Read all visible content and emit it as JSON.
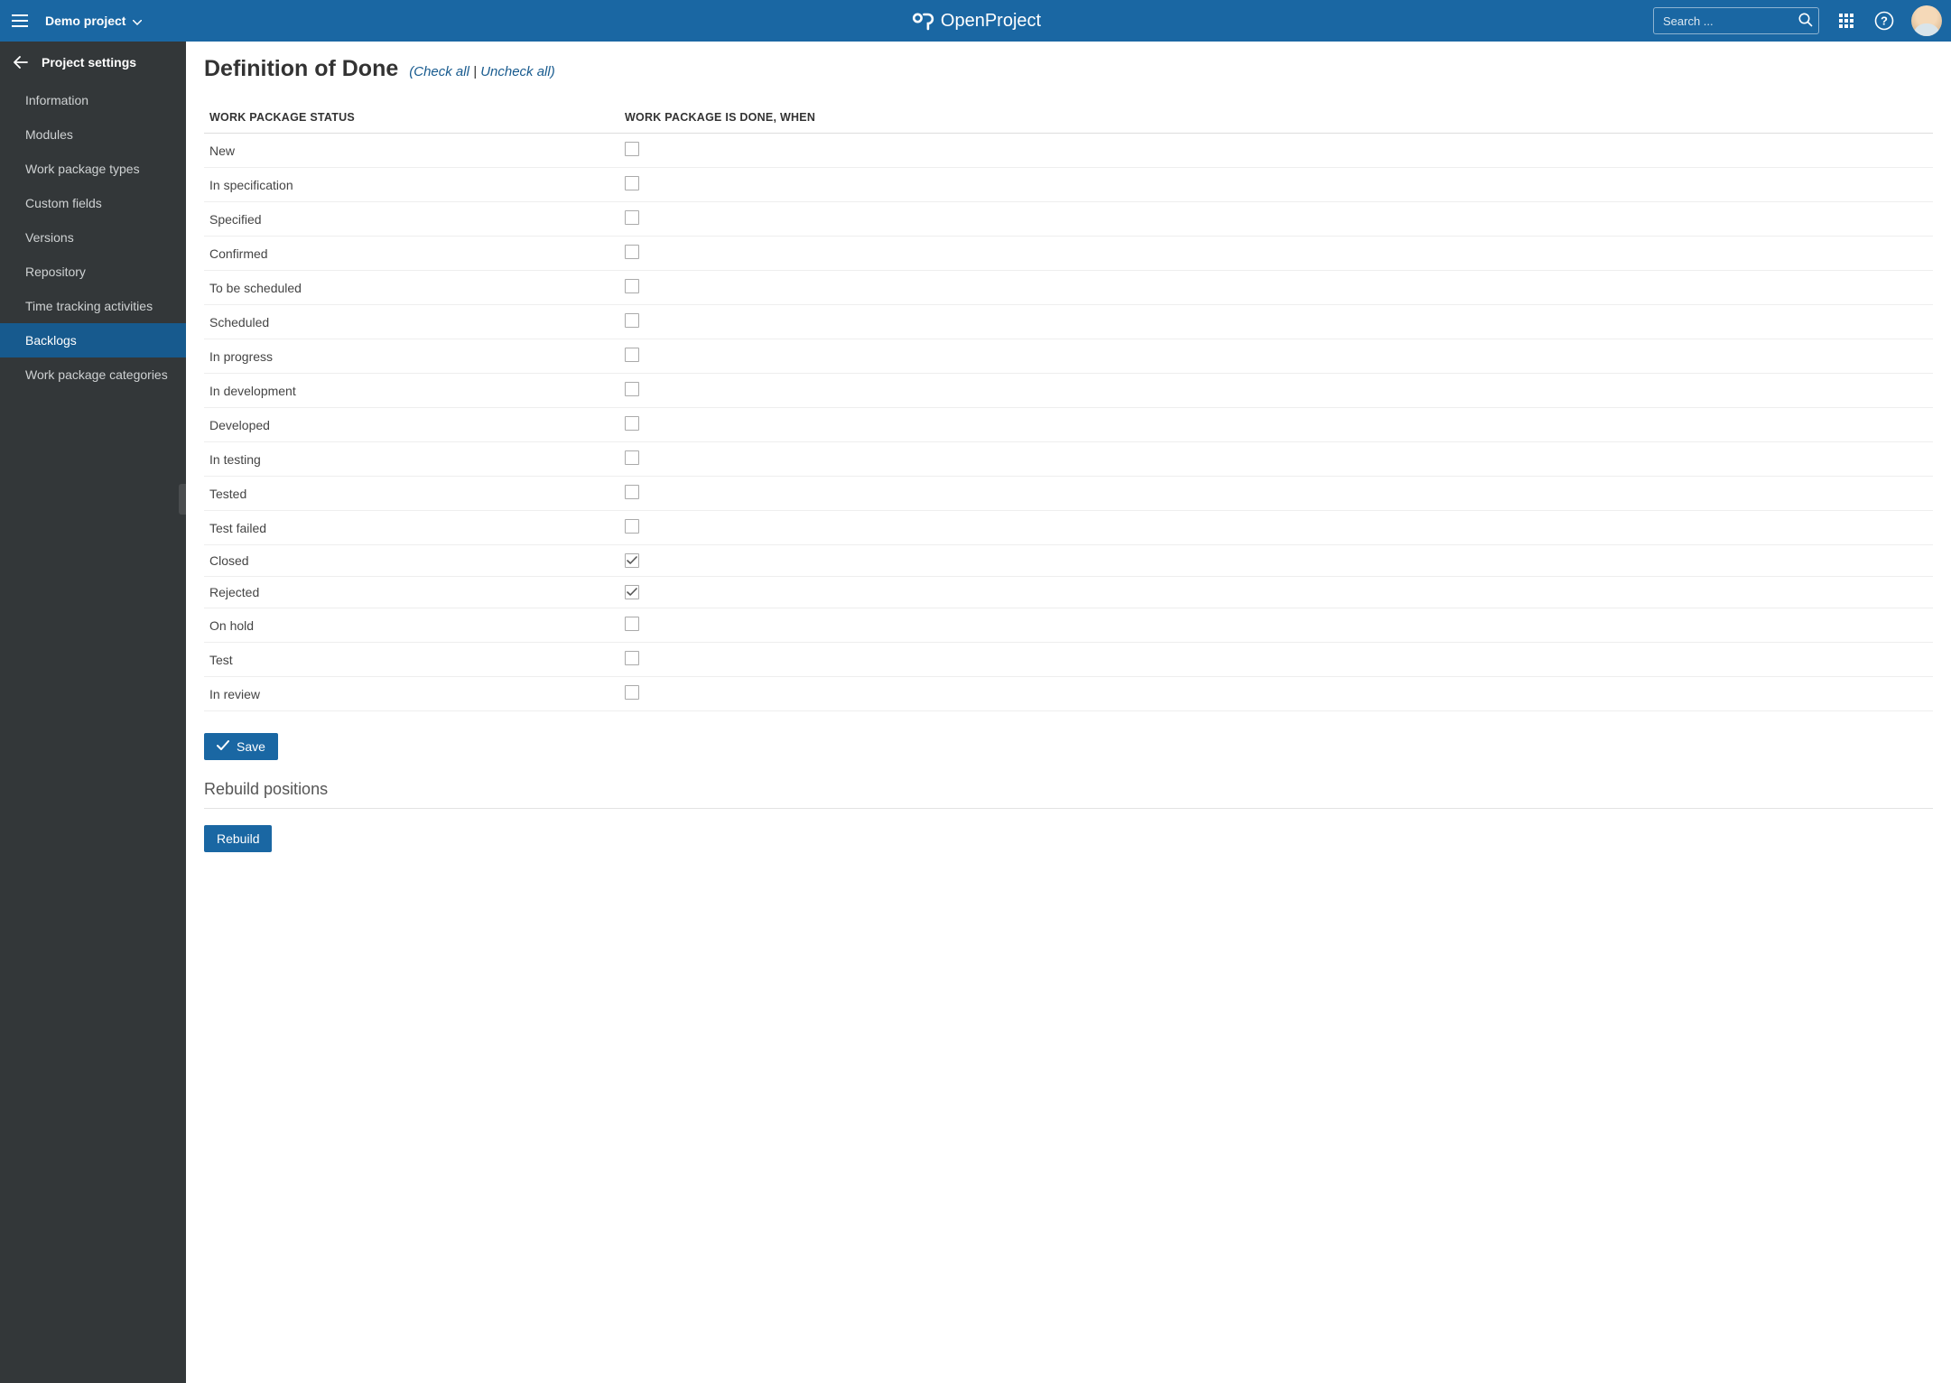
{
  "header": {
    "project_name": "Demo project",
    "search_placeholder": "Search ...",
    "logo_text": "OpenProject"
  },
  "sidebar": {
    "title": "Project settings",
    "items": [
      {
        "label": "Information",
        "active": false
      },
      {
        "label": "Modules",
        "active": false
      },
      {
        "label": "Work package types",
        "active": false
      },
      {
        "label": "Custom fields",
        "active": false
      },
      {
        "label": "Versions",
        "active": false
      },
      {
        "label": "Repository",
        "active": false
      },
      {
        "label": "Time tracking activities",
        "active": false
      },
      {
        "label": "Backlogs",
        "active": true
      },
      {
        "label": "Work package categories",
        "active": false
      }
    ]
  },
  "main": {
    "title": "Definition of Done",
    "check_all": "Check all",
    "uncheck_all": "Uncheck all",
    "col_status": "WORK PACKAGE STATUS",
    "col_done": "WORK PACKAGE IS DONE, WHEN",
    "statuses": [
      {
        "label": "New",
        "checked": false
      },
      {
        "label": "In specification",
        "checked": false
      },
      {
        "label": "Specified",
        "checked": false
      },
      {
        "label": "Confirmed",
        "checked": false
      },
      {
        "label": "To be scheduled",
        "checked": false
      },
      {
        "label": "Scheduled",
        "checked": false
      },
      {
        "label": "In progress",
        "checked": false
      },
      {
        "label": "In development",
        "checked": false
      },
      {
        "label": "Developed",
        "checked": false
      },
      {
        "label": "In testing",
        "checked": false
      },
      {
        "label": "Tested",
        "checked": false
      },
      {
        "label": "Test failed",
        "checked": false
      },
      {
        "label": "Closed",
        "checked": true
      },
      {
        "label": "Rejected",
        "checked": true
      },
      {
        "label": "On hold",
        "checked": false
      },
      {
        "label": "Test",
        "checked": false
      },
      {
        "label": "In review",
        "checked": false
      }
    ],
    "save_label": "Save",
    "rebuild_title": "Rebuild positions",
    "rebuild_label": "Rebuild"
  }
}
